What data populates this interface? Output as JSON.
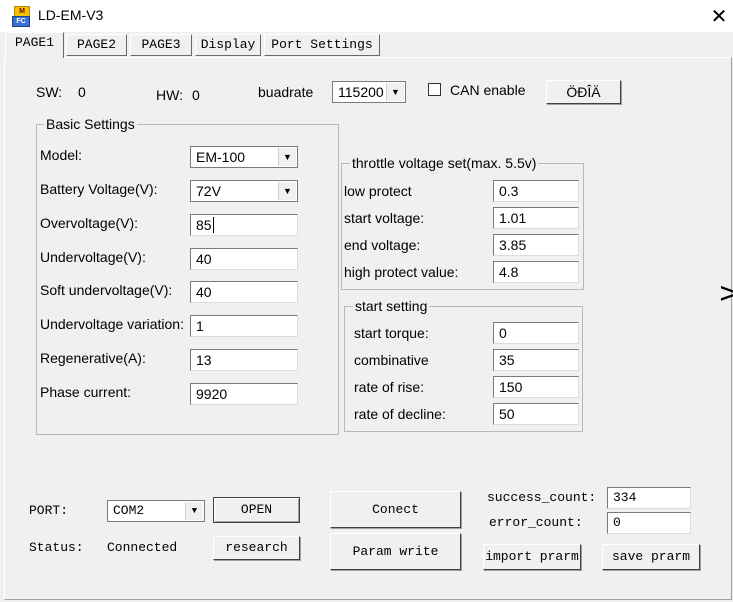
{
  "window": {
    "title": "LD-EM-V3",
    "app_icon": "app-icon",
    "close_icon": "close-icon"
  },
  "tabs": [
    {
      "label": "PAGE1",
      "active": true
    },
    {
      "label": "PAGE2",
      "active": false
    },
    {
      "label": "PAGE3",
      "active": false
    },
    {
      "label": "Display",
      "active": false
    },
    {
      "label": "Port Settings",
      "active": false
    }
  ],
  "header": {
    "sw_label": "SW:",
    "sw_value": "0",
    "hw_label": "HW:",
    "hw_value": "0",
    "baud_label": "buadrate",
    "baud_value": "115200",
    "can_label": "CAN enable",
    "can_checked": false,
    "garbled_button": "ÖÐÎÄ"
  },
  "basic": {
    "title": "Basic Settings",
    "model_label": "Model:",
    "model_value": "EM-100",
    "battery_label": "Battery Voltage(V):",
    "battery_value": "72V",
    "overvoltage_label": "Overvoltage(V):",
    "overvoltage_value": "85",
    "undervoltage_label": "Undervoltage(V):",
    "undervoltage_value": "40",
    "soft_label": "Soft undervoltage(V):",
    "soft_value": "40",
    "variation_label": "Undervoltage variation:",
    "variation_value": "1",
    "regen_label": "Regenerative(A):",
    "regen_value": "13",
    "phase_label": "Phase current:",
    "phase_value": "9920"
  },
  "throttle": {
    "title": "throttle voltage set(max. 5.5v)",
    "low_label": "low protect",
    "low_value": "0.3",
    "start_label": "start voltage:",
    "start_value": "1.01",
    "end_label": "end voltage:",
    "end_value": "3.85",
    "high_label": "high protect value:",
    "high_value": "4.8"
  },
  "start_setting": {
    "title": "start setting",
    "torque_label": "start torque:",
    "torque_value": "0",
    "comb_label": "combinative",
    "comb_value": "35",
    "rise_label": "rate of rise:",
    "rise_value": "150",
    "decline_label": "rate of decline:",
    "decline_value": "50"
  },
  "footer": {
    "port_label": "PORT:",
    "port_value": "COM2",
    "open_button": "OPEN",
    "status_label": "Status:",
    "status_value": "Connected",
    "research_button": "research",
    "connect_button": "Conect",
    "param_write_button": "Param write",
    "success_label": "success_count:",
    "success_value": "334",
    "error_label": "error_count:",
    "error_value": "0",
    "import_button": "import prarm",
    "save_button": "save prarm"
  },
  "background_edge_glyph": ">"
}
